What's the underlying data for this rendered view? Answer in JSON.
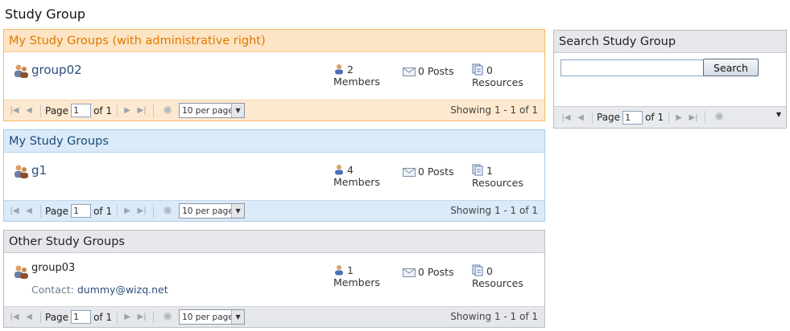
{
  "page": {
    "title": "Study Group"
  },
  "admin_panel": {
    "title": "My Study Groups (with administrative right)",
    "group": {
      "name": "group02",
      "members_count": "2",
      "members_label": "Members",
      "posts": "0 Posts",
      "resources_count": "0",
      "resources_label": "Resources"
    },
    "pager": {
      "page_label": "Page",
      "page_value": "1",
      "of_label": "of 1",
      "per_page": "10 per page",
      "showing": "Showing 1 - 1 of 1"
    }
  },
  "my_panel": {
    "title": "My Study Groups",
    "group": {
      "name": "g1",
      "members_count": "4",
      "members_label": "Members",
      "posts": "0 Posts",
      "resources_count": "1",
      "resources_label": "Resources"
    },
    "pager": {
      "page_label": "Page",
      "page_value": "1",
      "of_label": "of 1",
      "per_page": "10 per page",
      "showing": "Showing 1 - 1 of 1"
    }
  },
  "other_panel": {
    "title": "Other Study Groups",
    "group": {
      "name": "group03",
      "contact_label": "Contact:",
      "contact_email": "dummy@wizq.net",
      "members_count": "1",
      "members_label": "Members",
      "posts": "0 Posts",
      "resources_count": "0",
      "resources_label": "Resources"
    },
    "pager": {
      "page_label": "Page",
      "page_value": "1",
      "of_label": "of 1",
      "per_page": "10 per page",
      "showing": "Showing 1 - 1 of 1"
    }
  },
  "search_panel": {
    "title": "Search Study Group",
    "input_value": "",
    "button_label": "Search",
    "pager": {
      "page_label": "Page",
      "page_value": "1",
      "of_label": "of 1"
    }
  },
  "icons": {
    "group": "group-icon",
    "member": "member-icon",
    "posts": "envelope-icon",
    "resources": "document-icon",
    "first": "first-page-icon",
    "prev": "prev-page-icon",
    "next": "next-page-icon",
    "last": "last-page-icon",
    "refresh": "refresh-icon"
  },
  "colors": {
    "admin_title": "#e07800",
    "my_title": "#174a7c",
    "link": "#2a4f7c"
  }
}
